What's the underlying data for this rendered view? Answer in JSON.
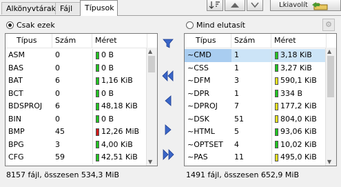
{
  "tabs": [
    "Alkönyvtárak",
    "Fájl",
    "Típusok"
  ],
  "toolbar": {
    "extract_label": "Lkiavolít",
    "sort_icon": "sort-icon",
    "up_icon": "up-icon",
    "down_icon": "down-icon",
    "folder_icon": "folder-icon"
  },
  "left": {
    "radio_label": "Csak ezek",
    "radio_checked": true,
    "columns": [
      "Típus",
      "Szám",
      "Méret"
    ],
    "rows": [
      {
        "type": "ASM",
        "count": "0",
        "size": "0 B",
        "color": "#22c322"
      },
      {
        "type": "BAS",
        "count": "0",
        "size": "0 B",
        "color": "#22c322"
      },
      {
        "type": "BAT",
        "count": "6",
        "size": "1,16 KiB",
        "color": "#22c322"
      },
      {
        "type": "BCT",
        "count": "0",
        "size": "0 B",
        "color": "#22c322"
      },
      {
        "type": "BDSPROJ",
        "count": "6",
        "size": "48,18 KiB",
        "color": "#22c322"
      },
      {
        "type": "BIN",
        "count": "0",
        "size": "0 B",
        "color": "#22c322"
      },
      {
        "type": "BMP",
        "count": "45",
        "size": "12,26 MiB",
        "color": "#d01818"
      },
      {
        "type": "BPG",
        "count": "3",
        "size": "4,00 KiB",
        "color": "#22c322"
      },
      {
        "type": "CFG",
        "count": "59",
        "size": "42,51 KiB",
        "color": "#22c322"
      }
    ],
    "status": "8157 fájl, összesen 534,3 MiB"
  },
  "right": {
    "radio_label": "Mind elutasít",
    "radio_checked": false,
    "columns": [
      "Típus",
      "Szám",
      "Méret"
    ],
    "rows": [
      {
        "type": "~CMD",
        "count": "1",
        "size": "3,18 KiB",
        "color": "#22c322",
        "selected": true
      },
      {
        "type": "~CSS",
        "count": "1",
        "size": "3,27 KiB",
        "color": "#22c322"
      },
      {
        "type": "~DFM",
        "count": "3",
        "size": "590,1 KiB",
        "color": "#e8e020"
      },
      {
        "type": "~DPR",
        "count": "1",
        "size": "334 B",
        "color": "#22c322"
      },
      {
        "type": "~DPROJ",
        "count": "7",
        "size": "177,2 KiB",
        "color": "#e8e020"
      },
      {
        "type": "~DSK",
        "count": "51",
        "size": "804,0 KiB",
        "color": "#e8e020"
      },
      {
        "type": "~HTML",
        "count": "5",
        "size": "93,06 KiB",
        "color": "#22c322"
      },
      {
        "type": "~OPTSET",
        "count": "4",
        "size": "10,02 KiB",
        "color": "#22c322"
      },
      {
        "type": "~PAS",
        "count": "11",
        "size": "495,0 KiB",
        "color": "#e8e020"
      }
    ],
    "status": "1491 fájl, összesen 652,9 MiB"
  },
  "middle_buttons": [
    "filter-icon",
    "move-all-left-icon",
    "move-left-icon",
    "move-right-icon",
    "move-all-right-icon"
  ]
}
